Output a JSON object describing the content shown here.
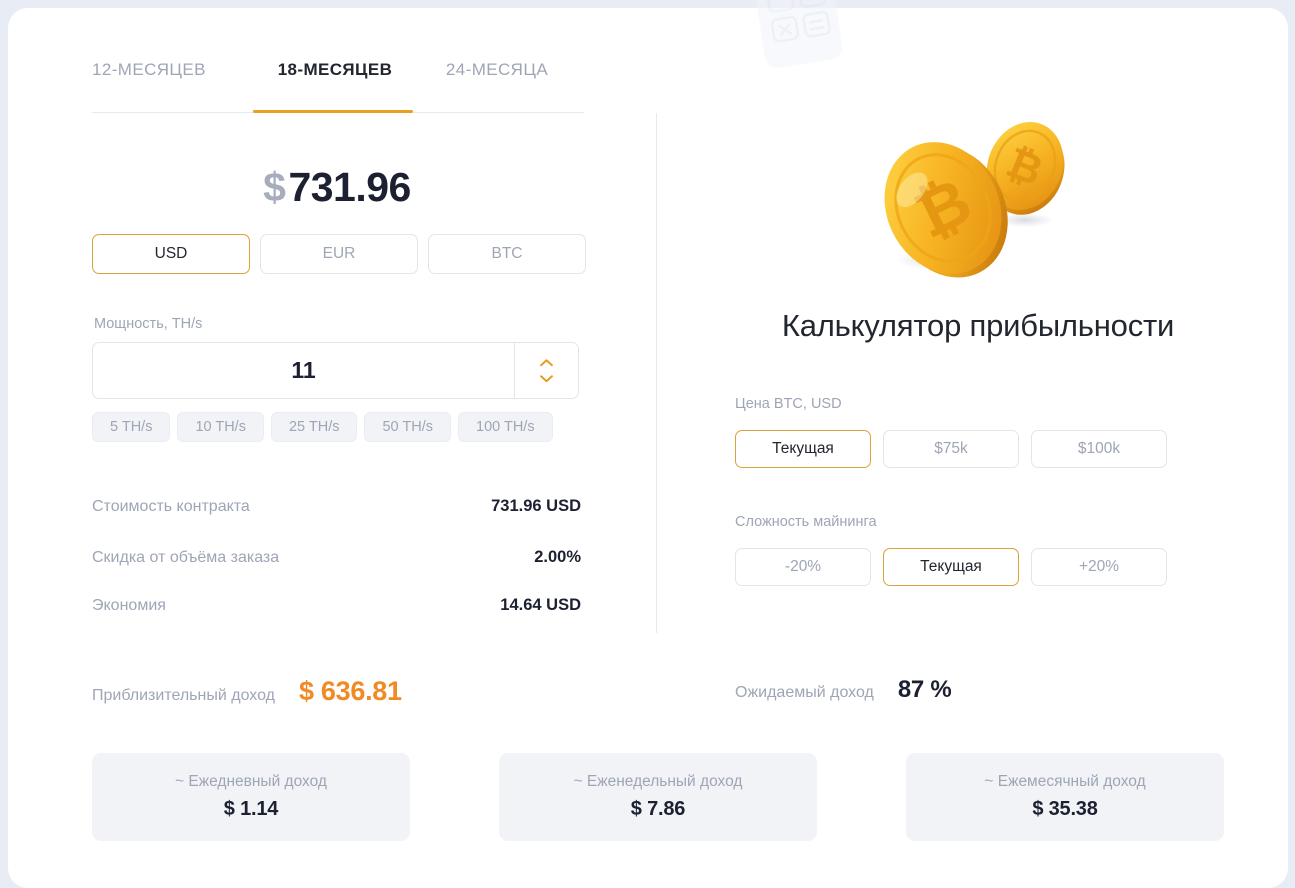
{
  "tabs": [
    {
      "label": "12-МЕСЯЦЕВ",
      "active": false
    },
    {
      "label": "18-МЕСЯЦЕВ",
      "active": true
    },
    {
      "label": "24-МЕСЯЦА",
      "active": false
    }
  ],
  "price": {
    "currency_symbol": "$",
    "amount": "731.96"
  },
  "currencies": [
    {
      "label": "USD",
      "active": true
    },
    {
      "label": "EUR",
      "active": false
    },
    {
      "label": "BTC",
      "active": false
    }
  ],
  "power": {
    "label": "Мощность, TH/s",
    "value": "11",
    "presets": [
      "5 TH/s",
      "10 TH/s",
      "25 TH/s",
      "50 TH/s",
      "100 TH/s"
    ]
  },
  "details": [
    {
      "key": "Стоимость контракта",
      "value": "731.96 USD"
    },
    {
      "key": "Скидка от объёма заказа",
      "value": "2.00%"
    },
    {
      "key": "Экономия",
      "value": "14.64 USD"
    }
  ],
  "calculator": {
    "title": "Калькулятор прибыльности",
    "btc_price_label": "Цена BTC, USD",
    "btc_price_options": [
      {
        "label": "Текущая",
        "active": true
      },
      {
        "label": "$75k",
        "active": false
      },
      {
        "label": "$100k",
        "active": false
      }
    ],
    "difficulty_label": "Сложность майнинга",
    "difficulty_options": [
      {
        "label": "-20%",
        "active": false
      },
      {
        "label": "Текущая",
        "active": true
      },
      {
        "label": "+20%",
        "active": false
      }
    ]
  },
  "summary": {
    "approx_label": "Приблизительный доход",
    "approx_value": "$ 636.81",
    "expected_label": "Ожидаемый доход",
    "expected_value": "87 %"
  },
  "income_cards": [
    {
      "title": "~ Ежедневный доход",
      "value": "$ 1.14"
    },
    {
      "title": "~ Еженедельный доход",
      "value": "$ 7.86"
    },
    {
      "title": "~ Ежемесячный доход",
      "value": "$ 35.38"
    }
  ],
  "colors": {
    "accent_orange": "#e8a020",
    "income_orange": "#f08a24",
    "active_border": "#d9a23a",
    "muted_text": "#9ea5b5",
    "dark_text": "#1c2030",
    "page_bg": "#e8ecf4",
    "chip_bg": "#f1f3f7"
  },
  "icons": {
    "watermark": "calculator-icon",
    "coins": "bitcoin-coins-illustration",
    "stepper_up": "chevron-up-icon",
    "stepper_down": "chevron-down-icon"
  }
}
